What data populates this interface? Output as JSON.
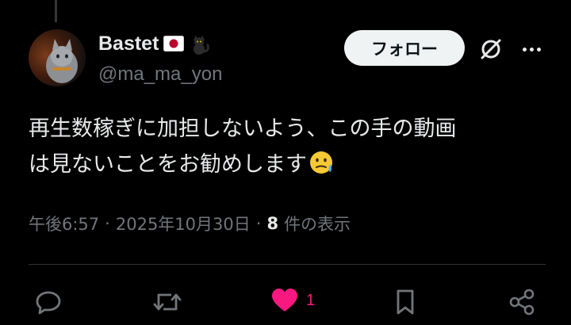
{
  "author": {
    "display_name": "Bastet",
    "handle": "@ma_ma_yon",
    "name_badges": [
      "japan-flag-emoji",
      "black-cat-emoji"
    ]
  },
  "header": {
    "follow_label": "フォロー"
  },
  "tweet": {
    "text": "再生数稼ぎに加担しないよう、この手の動画\nは見ないことをお勧めします",
    "trailing_emoji": "face-holding-back-tears-emoji"
  },
  "meta": {
    "time": "午後6:57",
    "separator": "·",
    "date": "2025年10月30日",
    "views_count": "8",
    "views_label": "件の表示"
  },
  "actions": {
    "like_count": "1",
    "like_color": "#f91880"
  },
  "icons": [
    "thread-line",
    "grok-icon",
    "more-icon",
    "reply-icon",
    "retweet-icon",
    "heart-icon",
    "bookmark-icon",
    "share-icon"
  ]
}
